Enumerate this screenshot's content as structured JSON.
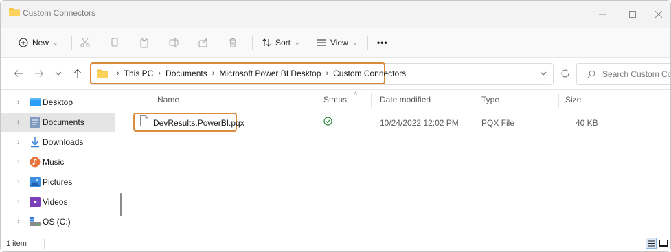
{
  "window": {
    "title": "Custom Connectors"
  },
  "toolbar": {
    "new_label": "New",
    "sort_label": "Sort",
    "view_label": "View",
    "more_label": "•••"
  },
  "address": {
    "crumbs": [
      "This PC",
      "Documents",
      "Microsoft Power BI Desktop",
      "Custom Connectors"
    ],
    "search_placeholder": "Search Custom Co..."
  },
  "nav": {
    "items": [
      {
        "label": "Desktop",
        "icon": "desktop-folder-icon"
      },
      {
        "label": "Documents",
        "icon": "documents-folder-icon",
        "selected": true
      },
      {
        "label": "Downloads",
        "icon": "downloads-icon"
      },
      {
        "label": "Music",
        "icon": "music-icon"
      },
      {
        "label": "Pictures",
        "icon": "pictures-icon"
      },
      {
        "label": "Videos",
        "icon": "videos-icon"
      },
      {
        "label": "OS (C:)",
        "icon": "drive-icon"
      }
    ]
  },
  "columns": {
    "name": "Name",
    "status": "Status",
    "date_modified": "Date modified",
    "type": "Type",
    "size": "Size"
  },
  "files": [
    {
      "name": "DevResults.PowerBI.pqx",
      "status": "synced",
      "date_modified": "10/24/2022 12:02 PM",
      "type": "PQX File",
      "size": "40 KB"
    }
  ],
  "status_bar": {
    "item_count": "1 item"
  },
  "colors": {
    "accent_highlight": "#d98b3a",
    "folder": "#f5c242",
    "status_ok": "#2e8b3d",
    "selected_bg": "#e5e5e5"
  }
}
